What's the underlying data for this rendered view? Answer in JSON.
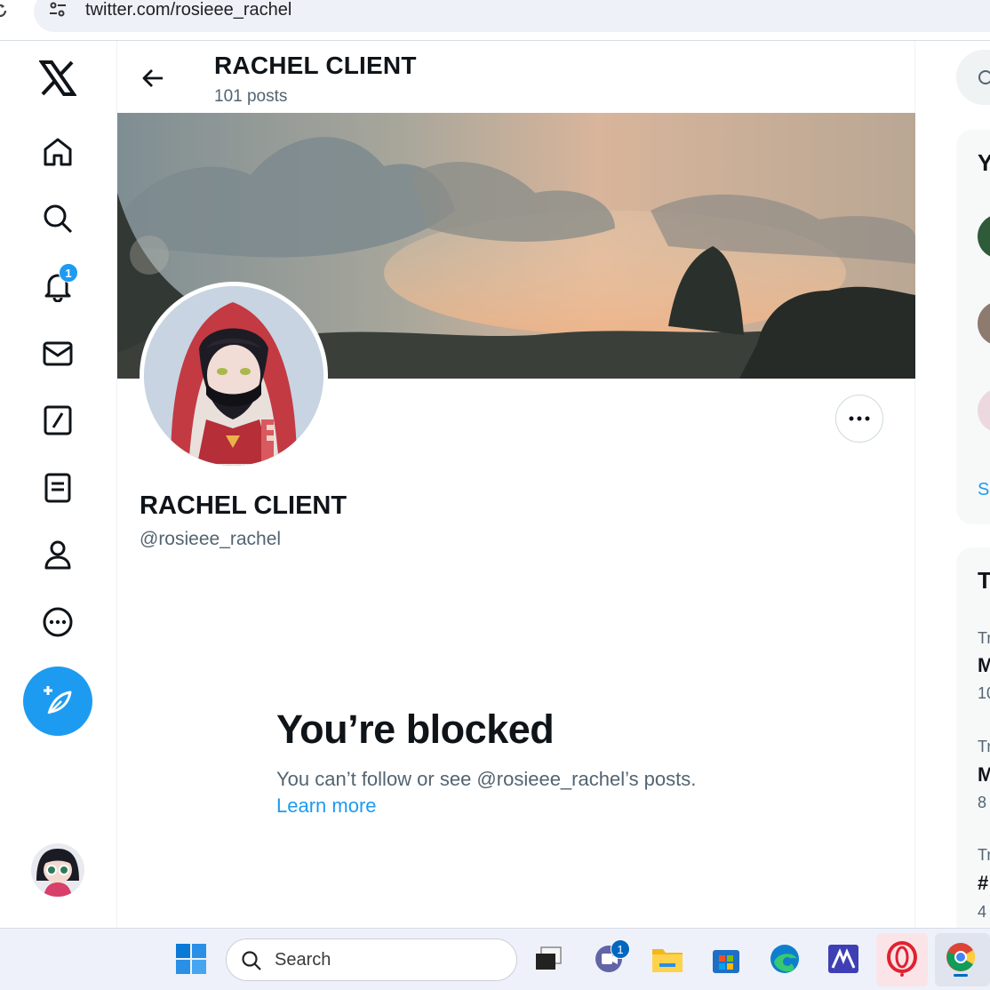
{
  "browser": {
    "url": "twitter.com/rosieee_rachel"
  },
  "nav": {
    "notifications_badge": "1"
  },
  "header": {
    "name": "RACHEL CLIENT",
    "post_count": "101 posts"
  },
  "profile": {
    "display_name": "RACHEL CLIENT",
    "handle": "@rosieee_rachel"
  },
  "blocked": {
    "title": "You’re blocked",
    "message": "You can’t follow or see @rosieee_rachel’s posts.",
    "learn_more": "Learn more"
  },
  "right_column": {
    "card1_heading": "Y",
    "card1_link": "S",
    "card2_heading": "T",
    "trend_rows": [
      {
        "label": "Tr",
        "title": "M",
        "count": "10"
      },
      {
        "label": "Tr",
        "title": "M",
        "count": "8"
      },
      {
        "label": "Tr",
        "title": "#",
        "count": "4"
      }
    ]
  },
  "taskbar": {
    "search_placeholder": "Search",
    "teams_badge": "1"
  },
  "colors": {
    "accent": "#1d9bf0",
    "text": "#0f1419",
    "secondary_text": "#536471"
  }
}
